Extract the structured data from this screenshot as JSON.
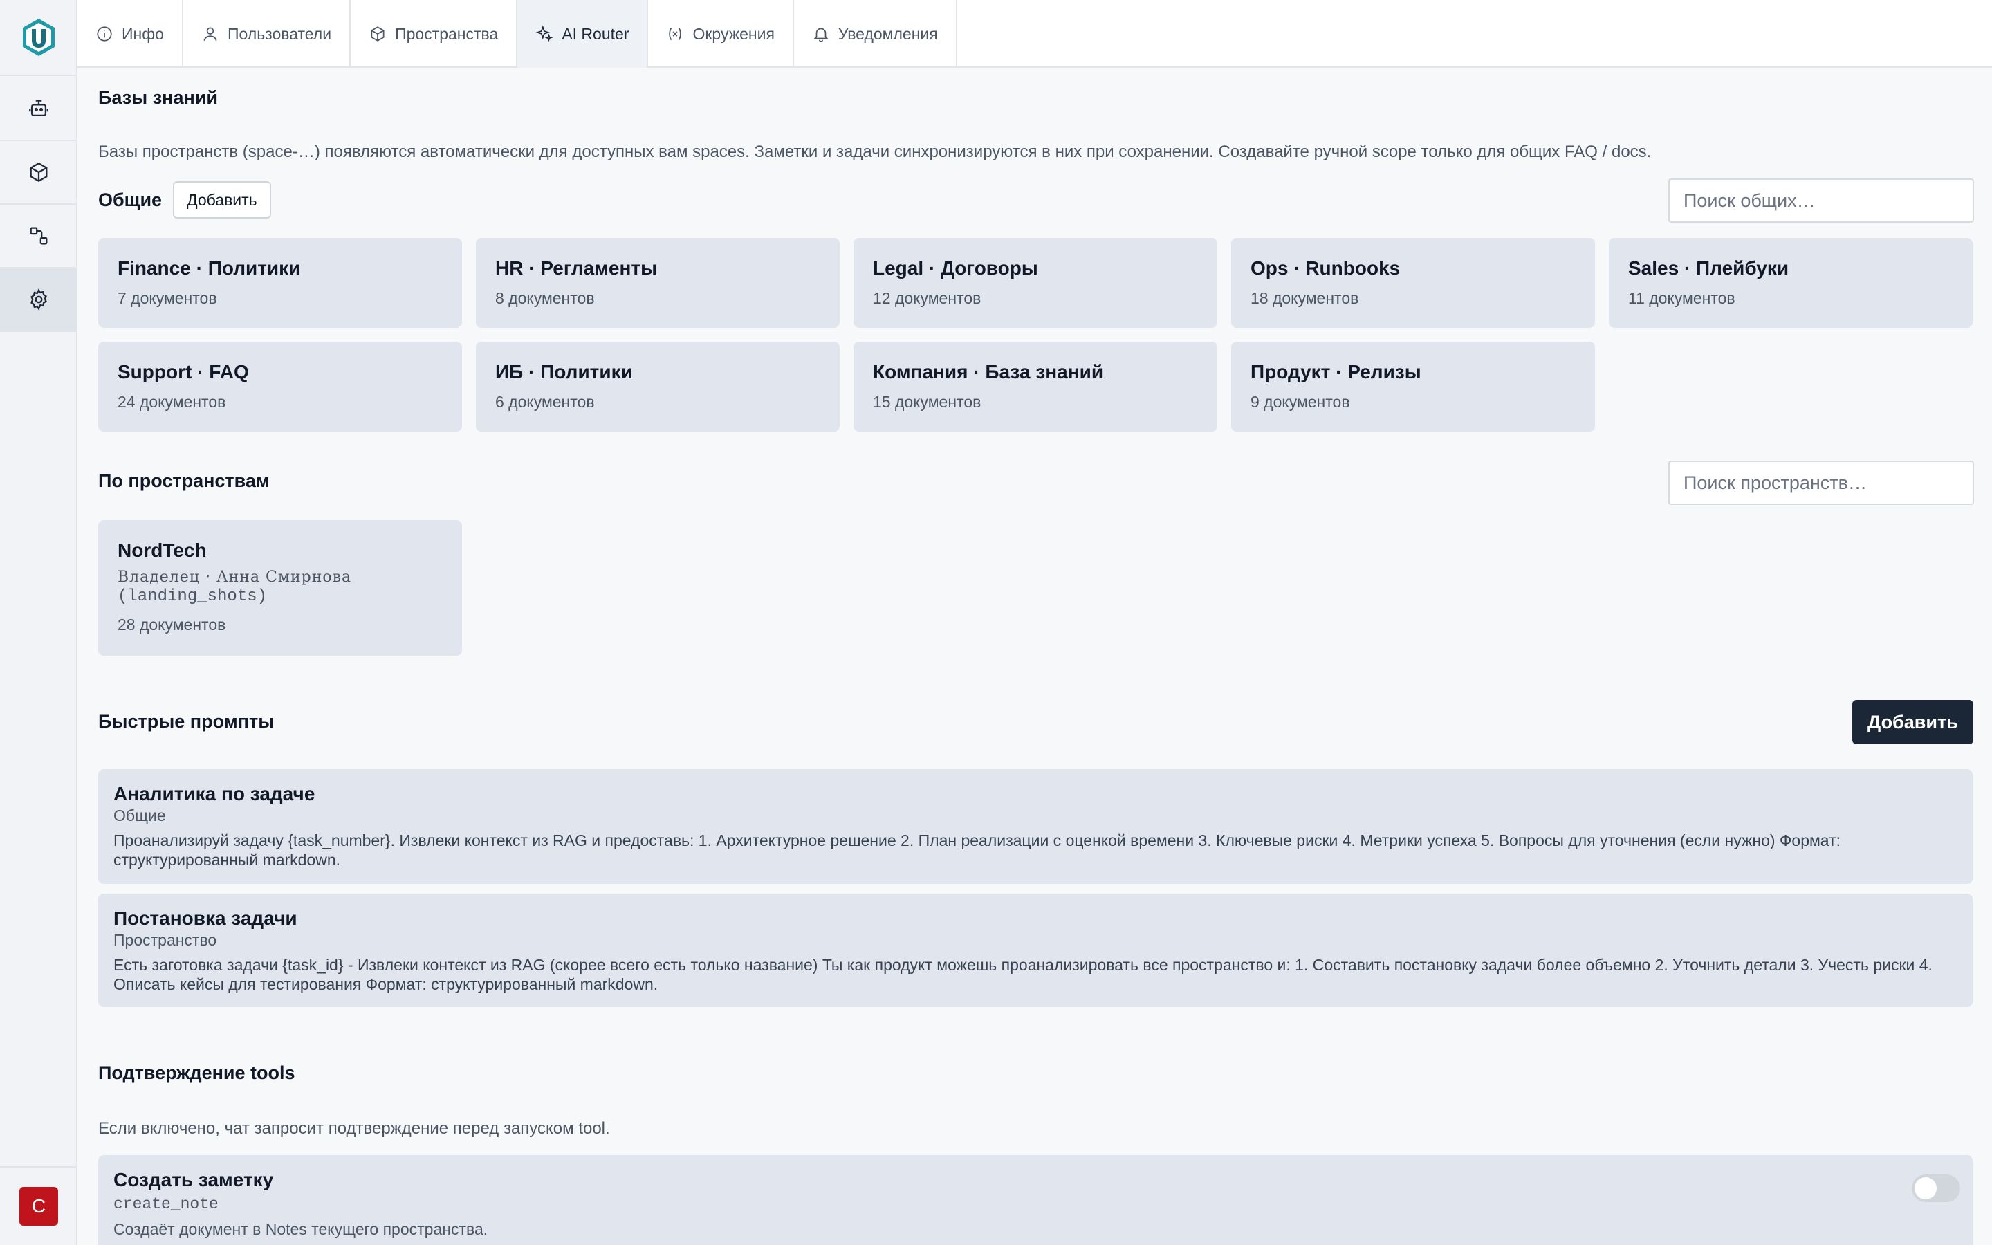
{
  "sidebar": {
    "avatar_letter": "С",
    "items": [
      {
        "icon": "bot-icon"
      },
      {
        "icon": "cube-icon"
      },
      {
        "icon": "workflow-icon"
      },
      {
        "icon": "gear-icon",
        "active": true
      }
    ]
  },
  "tabs": [
    {
      "label": "Инфо",
      "icon": "info-icon"
    },
    {
      "label": "Пользователи",
      "icon": "user-icon"
    },
    {
      "label": "Пространства",
      "icon": "cube-icon"
    },
    {
      "label": "AI Router",
      "icon": "sparkle-icon",
      "active": true
    },
    {
      "label": "Окружения",
      "icon": "variable-icon"
    },
    {
      "label": "Уведомления",
      "icon": "bell-icon"
    }
  ],
  "knowledge": {
    "title": "Базы знаний",
    "description": "Базы пространств (space-…) появляются автоматически для доступных вам spaces. Заметки и задачи синхронизируются в них при сохранении. Создавайте ручной scope только для общих FAQ / docs.",
    "common_label": "Общие",
    "add_label": "Добавить",
    "search_common_placeholder": "Поиск общих…",
    "common": [
      {
        "title": "Finance · Политики",
        "docs": "7 документов"
      },
      {
        "title": "HR · Регламенты",
        "docs": "8 документов"
      },
      {
        "title": "Legal · Договоры",
        "docs": "12 документов"
      },
      {
        "title": "Ops · Runbooks",
        "docs": "18 документов"
      },
      {
        "title": "Sales · Плейбуки",
        "docs": "11 документов"
      },
      {
        "title": "Support · FAQ",
        "docs": "24 документов"
      },
      {
        "title": "ИБ · Политики",
        "docs": "6 документов"
      },
      {
        "title": "Компания · База знаний",
        "docs": "15 документов"
      },
      {
        "title": "Продукт · Релизы",
        "docs": "9 документов"
      }
    ],
    "spaces_label": "По пространствам",
    "search_spaces_placeholder": "Поиск пространств…",
    "spaces": [
      {
        "title": "NordTech",
        "owner": "Владелец · Анна Смирнова",
        "login": "(landing_shots)",
        "docs": "28 документов"
      }
    ]
  },
  "prompts": {
    "title": "Быстрые промпты",
    "add_label": "Добавить",
    "items": [
      {
        "title": "Аналитика по задаче",
        "scope": "Общие",
        "text": "Проанализируй задачу {task_number}. Извлеки контекст из RAG и предоставь: 1. Архитектурное решение 2. План реализации с оценкой времени 3. Ключевые риски 4. Метрики успеха 5. Вопросы для уточнения (если нужно) Формат: структурированный markdown."
      },
      {
        "title": "Постановка задачи",
        "scope": "Пространство",
        "text": "Есть заготовка задачи {task_id} - Извлеки контекст из RAG (скорее всего есть только название) Ты как продукт можешь проанализировать все пространство и: 1. Составить постановку задачи более объемно 2. Уточнить детали 3. Учесть риски 4. Описать кейсы для тестирования Формат: структурированный markdown."
      }
    ]
  },
  "tools": {
    "title": "Подтверждение tools",
    "description": "Если включено, чат запросит подтверждение перед запуском tool.",
    "items": [
      {
        "title": "Создать заметку",
        "code": "create_note",
        "description": "Создаёт документ в Notes текущего пространства.",
        "enabled": false
      }
    ]
  }
}
